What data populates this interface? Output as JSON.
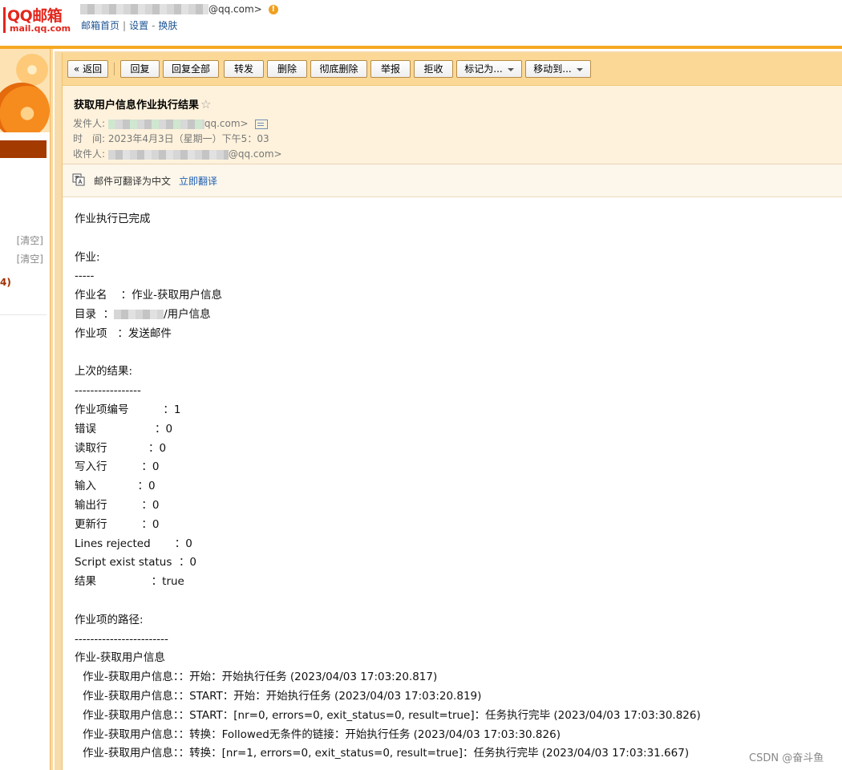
{
  "header": {
    "logo_main": "QQ邮箱",
    "logo_sub": "mail.qq.com",
    "account_suffix": "@qq.com>",
    "links": [
      "邮箱首页",
      "设置",
      "换肤"
    ],
    "link_separators": [
      "|",
      "-"
    ]
  },
  "sidebar": {
    "clear_1": "[清空]",
    "clear_2": "[清空]",
    "count": "4)"
  },
  "toolbar": {
    "back": "« 返回",
    "reply": "回复",
    "reply_all": "回复全部",
    "forward": "转发",
    "delete": "删除",
    "delete_forever": "彻底删除",
    "report": "举报",
    "reject": "拒收",
    "mark_as": "标记为...",
    "move_to": "移动到..."
  },
  "mail": {
    "subject": "获取用户信息作业执行结果",
    "star": "☆",
    "from_label": "发件人:",
    "from_suffix": "qq.com>",
    "time_label": "时　间:",
    "time_value": "2023年4月3日（星期一）下午5：03",
    "to_label": "收件人:",
    "to_suffix": "@qq.com>"
  },
  "translate": {
    "text": "邮件可翻译为中文",
    "link": "立即翻译"
  },
  "body_lines": [
    {
      "text": "作业执行已完成",
      "indent": false
    },
    {
      "text": "",
      "indent": false
    },
    {
      "text": "作业:",
      "indent": false
    },
    {
      "text": "-----",
      "indent": false
    },
    {
      "text": "作业名    ：作业-获取用户信息",
      "indent": false
    },
    {
      "text": "目录  ：",
      "indent": false,
      "blur_after": true,
      "rest": "/用户信息"
    },
    {
      "text": "作业项   ：发送邮件",
      "indent": false
    },
    {
      "text": "",
      "indent": false
    },
    {
      "text": "上次的结果:",
      "indent": false
    },
    {
      "text": "-----------------",
      "indent": false
    },
    {
      "text": "作业项编号          ：1",
      "indent": false
    },
    {
      "text": "错误                 ：0",
      "indent": false
    },
    {
      "text": "读取行            ：0",
      "indent": false
    },
    {
      "text": "写入行          ：0",
      "indent": false
    },
    {
      "text": "输入            ：0",
      "indent": false
    },
    {
      "text": "输出行          ：0",
      "indent": false
    },
    {
      "text": "更新行          ：0",
      "indent": false
    },
    {
      "text": "Lines rejected       ：0",
      "indent": false
    },
    {
      "text": "Script exist status  ：0",
      "indent": false
    },
    {
      "text": "结果                ：true",
      "indent": false
    },
    {
      "text": "",
      "indent": false
    },
    {
      "text": "作业项的路径:",
      "indent": false
    },
    {
      "text": "------------------------",
      "indent": false
    },
    {
      "text": "作业-获取用户信息",
      "indent": false
    },
    {
      "text": "作业-获取用户信息：：开始：开始执行任务 (2023/04/03 17:03:20.817)",
      "indent": true
    },
    {
      "text": "作业-获取用户信息：：START：开始：开始执行任务 (2023/04/03 17:03:20.819)",
      "indent": true
    },
    {
      "text": "作业-获取用户信息：：START：[nr=0, errors=0, exit_status=0, result=true]：任务执行完毕 (2023/04/03 17:03:30.826)",
      "indent": true
    },
    {
      "text": "作业-获取用户信息：：转换：Followed无条件的链接：开始执行任务 (2023/04/03 17:03:30.826)",
      "indent": true
    },
    {
      "text": "作业-获取用户信息：：转换：[nr=1, errors=0, exit_status=0, result=true]：任务执行完毕 (2023/04/03 17:03:31.667)",
      "indent": true
    }
  ],
  "watermark": "CSDN @奋斗鱼",
  "colors": {
    "accent_orange": "#f6a823",
    "logo_red": "#e3261c",
    "toolbar_bg": "#fbd896",
    "link_blue": "#1e5fb4"
  }
}
